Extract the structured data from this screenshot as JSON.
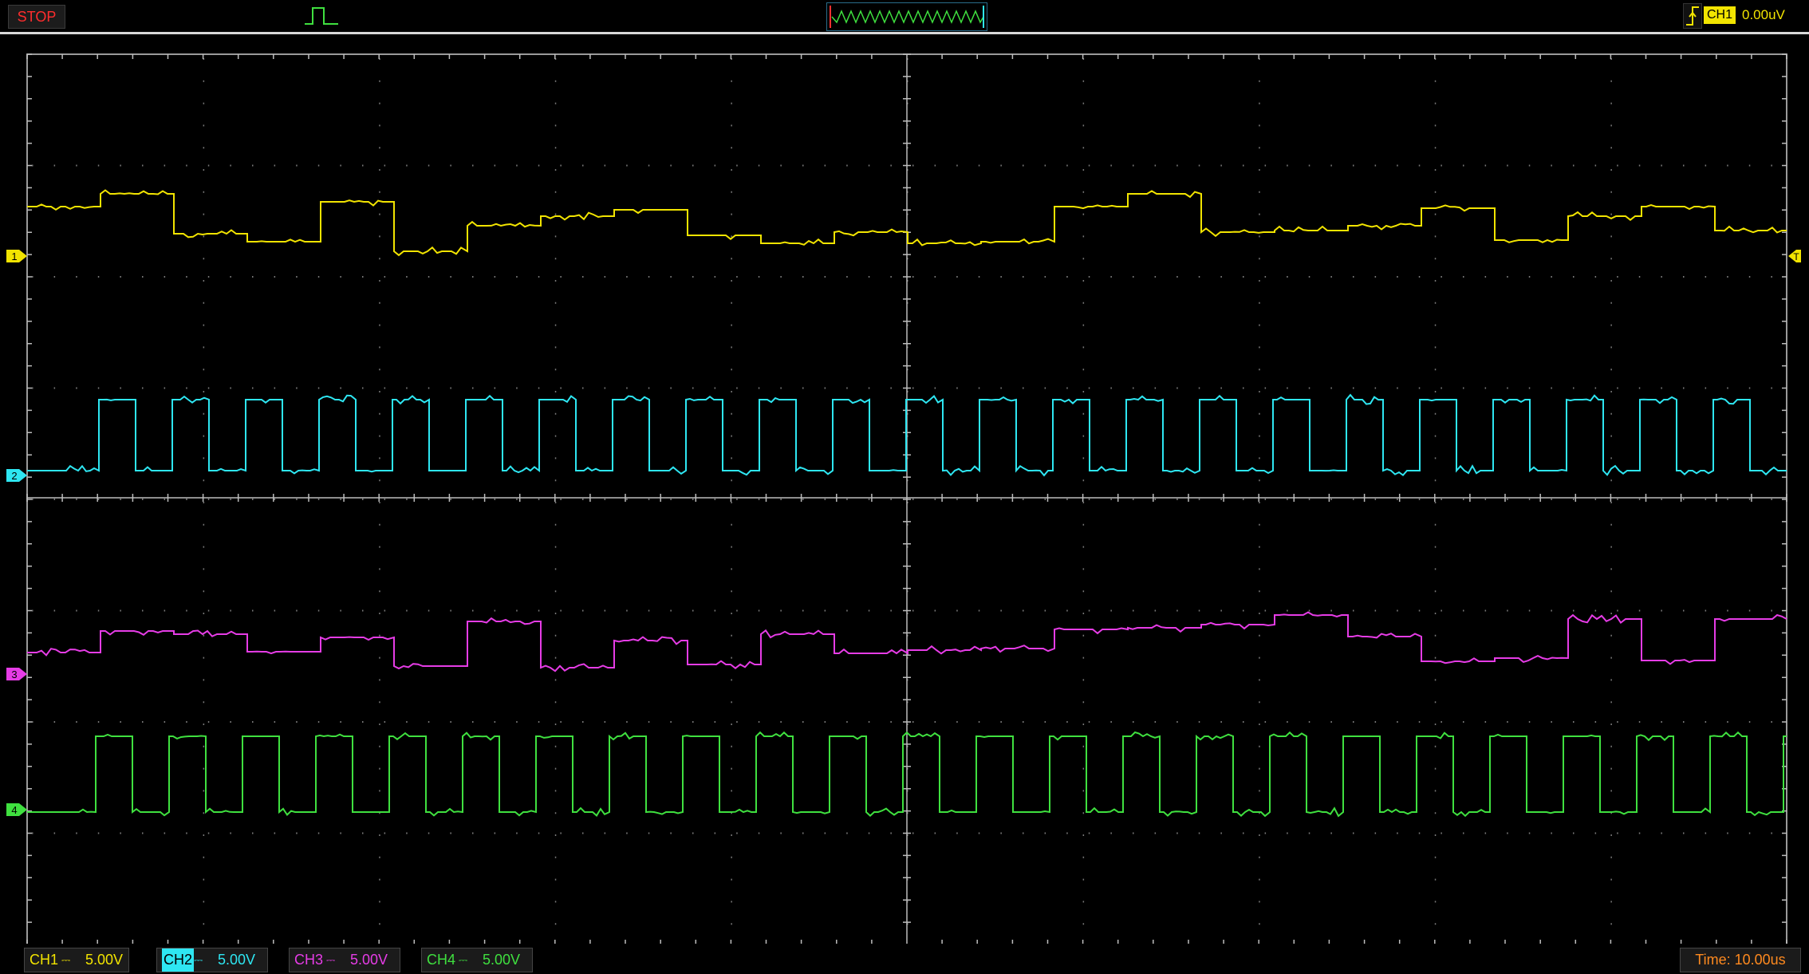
{
  "toolbar": {
    "run_state": "STOP",
    "trigger_mode_icon": "single-pulse-icon",
    "waveform_preview_icon": "waveform-preview-icon",
    "trigger_edge_icon": "rising-edge-icon",
    "trigger_channel": "CH1",
    "trigger_level": "0.00uV"
  },
  "markers": {
    "ch1": "1",
    "ch2": "2",
    "ch3": "3",
    "ch4": "4",
    "trigger": "T"
  },
  "channels": [
    {
      "name": "CH1",
      "scale": "5.00V",
      "color": "#f2e400"
    },
    {
      "name": "CH2",
      "scale": "5.00V",
      "color": "#2ee6f2"
    },
    {
      "name": "CH3",
      "scale": "5.00V",
      "color": "#e63ce6"
    },
    {
      "name": "CH4",
      "scale": "5.00V",
      "color": "#3fe03f"
    }
  ],
  "timebase": "Time: 10.00us",
  "colors": {
    "stop": "#ff2d2d",
    "grid": "#8c8c8c",
    "timebase": "#ff8a1f"
  }
}
